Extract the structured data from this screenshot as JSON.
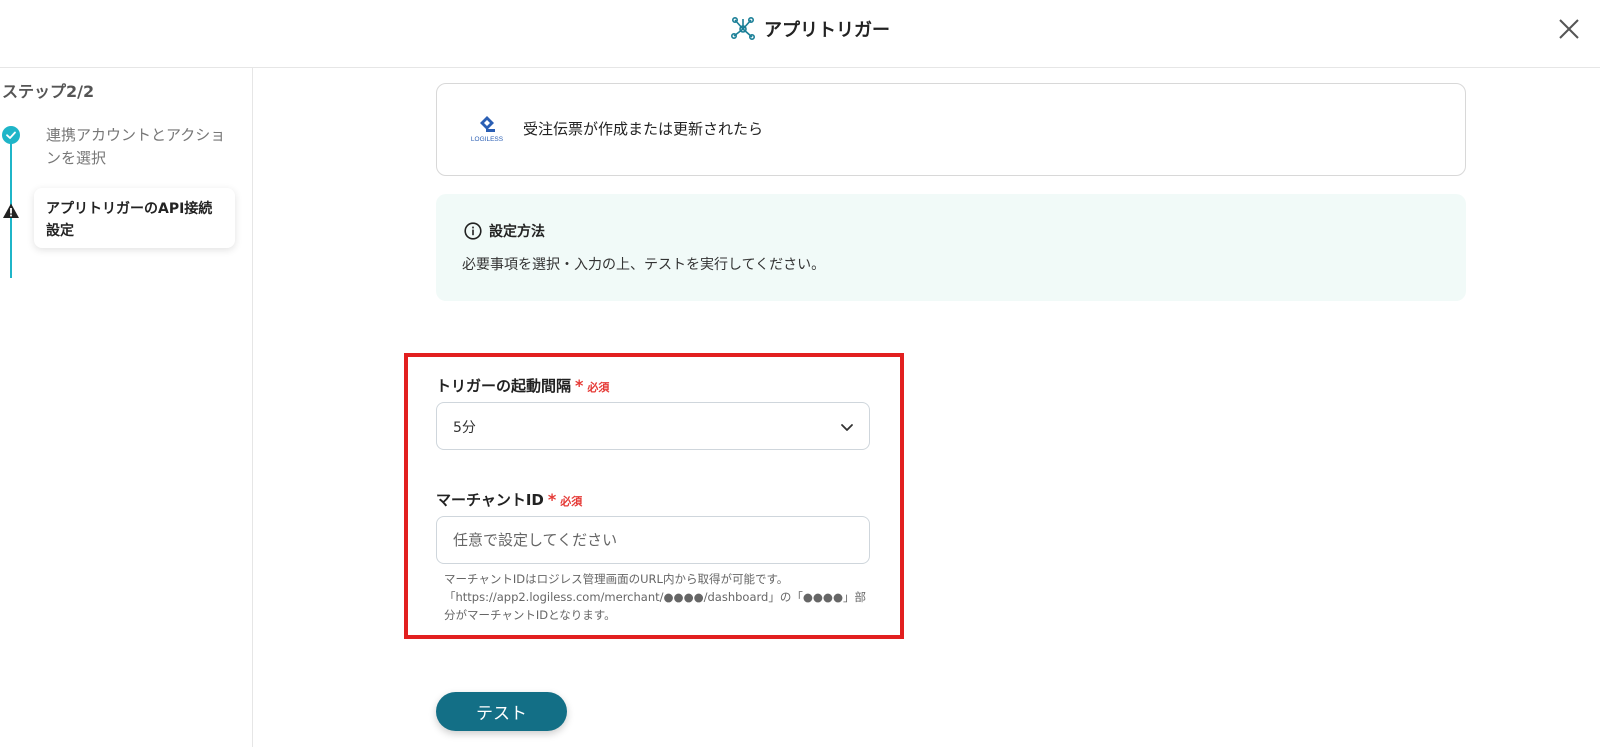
{
  "header": {
    "title": "アプリトリガー",
    "icon": "network-nodes-icon",
    "close_icon": "close-icon"
  },
  "sidebar": {
    "step_label": "ステップ2/2",
    "steps": [
      {
        "label": "連携アカウントとアクションを選択",
        "status": "completed",
        "icon": "check-circle-icon"
      },
      {
        "label": "アプリトリガーのAPI接続設定",
        "status": "warning",
        "icon": "warning-triangle-icon"
      }
    ]
  },
  "app_card": {
    "logo_text": "LOGILESS",
    "trigger_text": "受注伝票が作成または更新されたら"
  },
  "info": {
    "title": "設定方法",
    "text": "必要事項を選択・入力の上、テストを実行してください。",
    "icon": "info-icon"
  },
  "form": {
    "interval": {
      "label": "トリガーの起動間隔",
      "required_mark": "*",
      "required_text": "必須",
      "value": "5分"
    },
    "merchant": {
      "label": "マーチャントID",
      "required_mark": "*",
      "required_text": "必須",
      "value": "",
      "placeholder": "任意で設定してください",
      "help": "マーチャントIDはロジレス管理画面のURL内から取得が可能です。「https://app2.logiless.com/merchant/●●●●/dashboard」の「●●●●」部分がマーチャントIDとなります。"
    }
  },
  "test_button": {
    "label": "テスト"
  },
  "colors": {
    "accent": "#1fb5c8",
    "primary_button": "#136f86",
    "required": "#e53935",
    "highlight_frame": "#e21f1f",
    "info_bg": "#f1faf8"
  }
}
